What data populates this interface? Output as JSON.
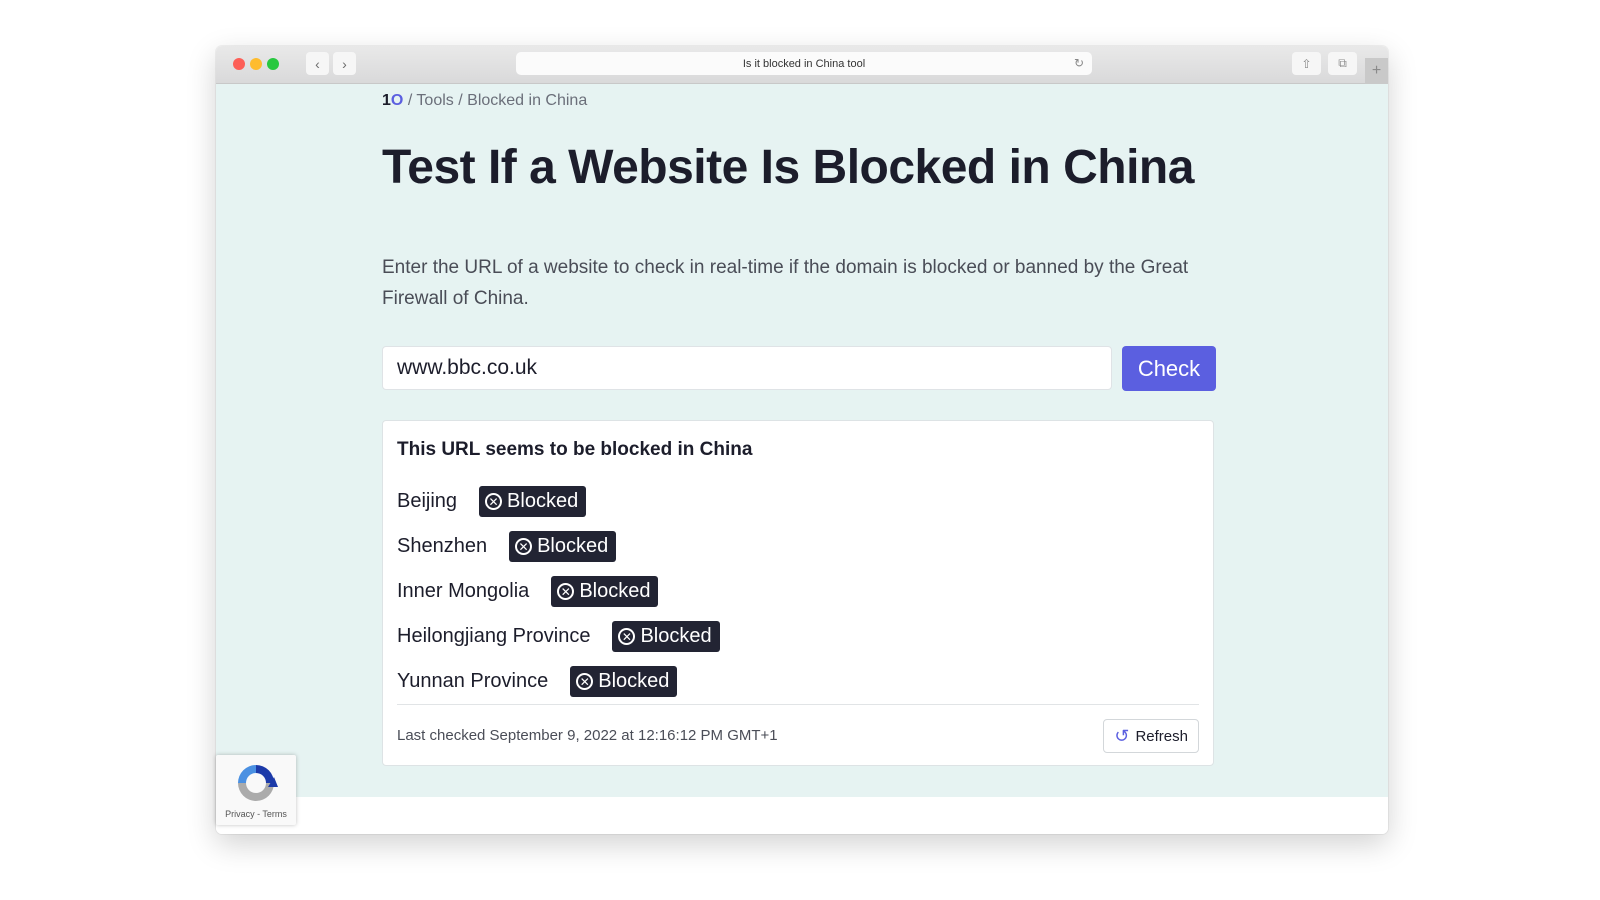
{
  "browser": {
    "address_text": "Is it blocked in China tool",
    "icons": {
      "back": "chevron-left-icon",
      "forward": "chevron-right-icon",
      "reload": "reload-icon",
      "share": "share-icon",
      "tabs": "tabs-icon",
      "new_tab": "plus-icon"
    }
  },
  "breadcrumb": {
    "logo": "1",
    "logo_accent": "O",
    "separator": "/",
    "items": [
      "Tools",
      "Blocked in China"
    ]
  },
  "page": {
    "title": "Test If a Website Is Blocked in China",
    "description": "Enter the URL of a website to check in real-time if the domain is blocked or banned by the Great Firewall of China.",
    "url_input": {
      "value": "www.bbc.co.uk"
    },
    "check_button": "Check"
  },
  "result": {
    "title": "This URL seems to be blocked in China",
    "locations": [
      {
        "name": "Beijing",
        "status": "Blocked"
      },
      {
        "name": "Shenzhen",
        "status": "Blocked"
      },
      {
        "name": "Inner Mongolia",
        "status": "Blocked"
      },
      {
        "name": "Heilongjiang Province",
        "status": "Blocked"
      },
      {
        "name": "Yunnan Province",
        "status": "Blocked"
      }
    ],
    "last_checked": "Last checked September 9, 2022 at 12:16:12 PM GMT+1",
    "refresh_button": "Refresh"
  },
  "recaptcha": {
    "text": "Privacy - Terms"
  },
  "colors": {
    "accent": "#5b5fe0",
    "page_background": "#e6f3f2",
    "badge_background": "#222433",
    "text": "#1c1d2b"
  }
}
